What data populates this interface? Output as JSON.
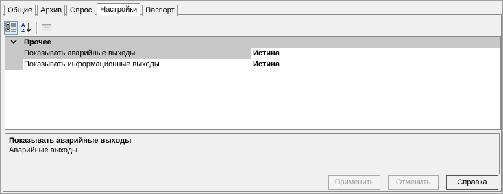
{
  "tabs": [
    {
      "label": "Общие"
    },
    {
      "label": "Архив"
    },
    {
      "label": "Опрос"
    },
    {
      "label": "Настройки"
    },
    {
      "label": "Паспорт"
    }
  ],
  "active_tab": "Настройки",
  "toolbar": {
    "categorized_icon": "categorized-view-icon",
    "alphabetical_icon": "alphabetical-sort-icon",
    "property_pages_icon": "property-pages-icon"
  },
  "grid": {
    "category": "Прочее",
    "rows": [
      {
        "name": "Показывать аварийные выходы",
        "value": "Истина"
      },
      {
        "name": "Показывать информационные выходы",
        "value": "Истина"
      }
    ]
  },
  "description": {
    "title": "Показывать аварийные выходы",
    "text": "Аварийные выходы"
  },
  "buttons": {
    "apply": "Применить",
    "cancel": "Отменить",
    "help": "Справка"
  }
}
